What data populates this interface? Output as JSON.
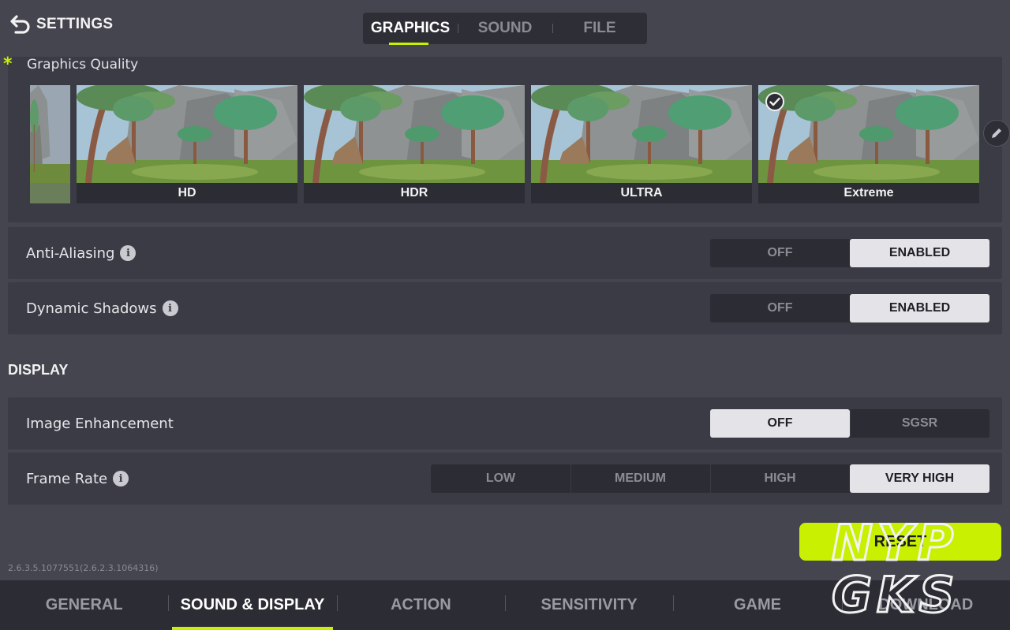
{
  "header": {
    "back_label": "SETTINGS",
    "tabs": [
      {
        "label": "GRAPHICS",
        "active": true
      },
      {
        "label": "SOUND",
        "active": false
      },
      {
        "label": "FILE",
        "active": false
      }
    ]
  },
  "graphics_quality": {
    "title": "Graphics Quality",
    "options": [
      {
        "label": "HD"
      },
      {
        "label": "HDR"
      },
      {
        "label": "ULTRA"
      },
      {
        "label": "Extreme",
        "selected": true
      }
    ]
  },
  "graphics_settings": [
    {
      "label": "Anti-Aliasing",
      "options": [
        "OFF",
        "ENABLED"
      ],
      "selected": "ENABLED",
      "info": true
    },
    {
      "label": "Dynamic Shadows",
      "options": [
        "OFF",
        "ENABLED"
      ],
      "selected": "ENABLED",
      "info": true
    }
  ],
  "display": {
    "section_title": "DISPLAY",
    "image_enhancement": {
      "label": "Image Enhancement",
      "options": [
        "OFF",
        "SGSR"
      ],
      "selected": "OFF"
    },
    "frame_rate": {
      "label": "Frame Rate",
      "options": [
        "LOW",
        "MEDIUM",
        "HIGH",
        "VERY HIGH"
      ],
      "selected": "VERY HIGH"
    }
  },
  "reset_label": "RESET",
  "version": "2.6.3.5.1077551(2.6.2.3.1064316)",
  "bottom_nav": [
    {
      "label": "GENERAL",
      "active": false
    },
    {
      "label": "SOUND & DISPLAY",
      "active": true
    },
    {
      "label": "ACTION",
      "active": false
    },
    {
      "label": "SENSITIVITY",
      "active": false
    },
    {
      "label": "GAME",
      "active": false
    },
    {
      "label": "DOWNLOAD",
      "active": false
    }
  ],
  "watermark": {
    "line1": "NYP",
    "line2": "GKS"
  },
  "colors": {
    "accent": "#c8f000",
    "background": "#45454f",
    "panel": "#3b3b45"
  },
  "icons": [
    "back-arrow-icon",
    "info-icon",
    "checkmark-icon",
    "pencil-icon"
  ]
}
